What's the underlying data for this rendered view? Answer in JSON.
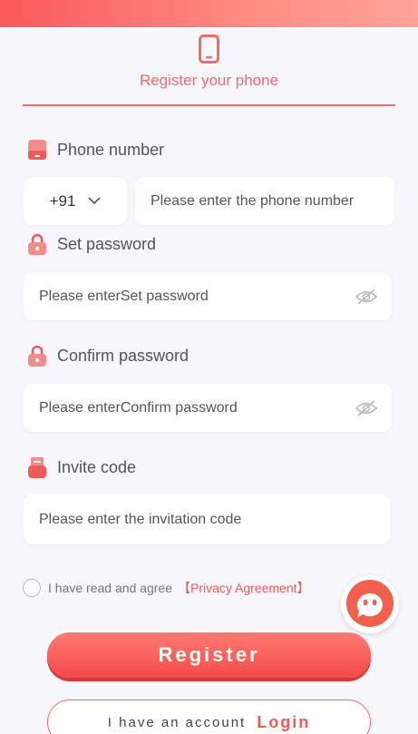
{
  "header": {
    "tab_title": "Register your phone",
    "tab_icon": "mobile-phone-icon"
  },
  "phone": {
    "label": "Phone number",
    "country_code": "+91",
    "placeholder": "Please enter the phone number"
  },
  "password": {
    "label": "Set password",
    "placeholder": "Please enterSet password"
  },
  "confirm": {
    "label": "Confirm password",
    "placeholder": "Please enterConfirm password"
  },
  "invite": {
    "label": "Invite code",
    "placeholder": "Please enter the invitation code"
  },
  "agreement": {
    "text": "I have read and agree",
    "link": "【Privacy Agreement】",
    "checked": false
  },
  "buttons": {
    "register": "Register",
    "have_account": "I have an account",
    "login": "Login"
  },
  "colors": {
    "accent": "#f36c6c",
    "background": "#f6f6fb"
  }
}
